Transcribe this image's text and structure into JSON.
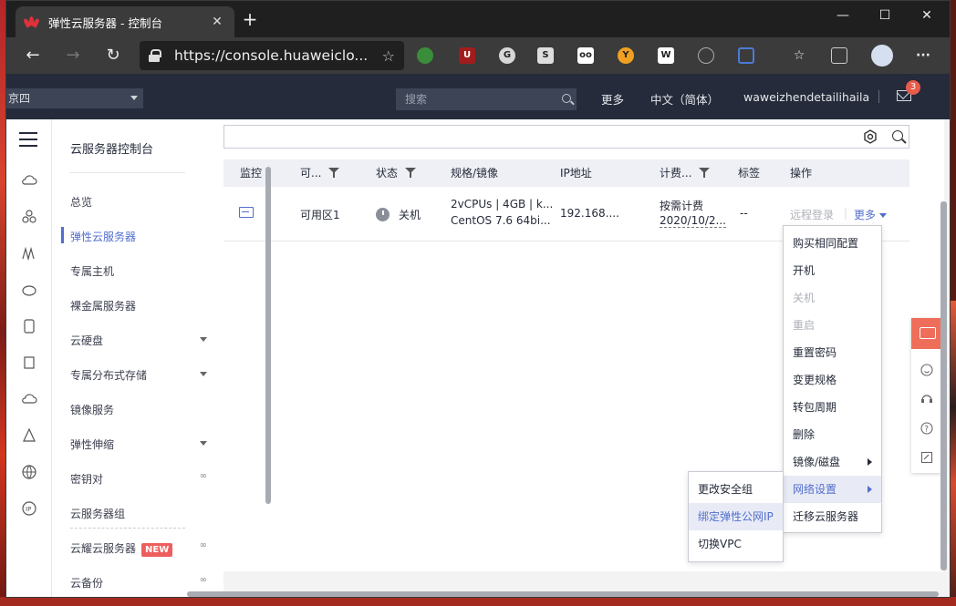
{
  "browser": {
    "tab_title": "弹性云服务器 - 控制台",
    "url": "https://console.huaweiclo...",
    "new_tab": "+",
    "close_tab": "✕",
    "controls": {
      "minimize": "—",
      "maximize": "☐",
      "close": "✕"
    }
  },
  "topbar": {
    "region": "京四",
    "search_placeholder": "搜索",
    "more": "更多",
    "language": "中文（简体）",
    "username": "waweizhendetailihaila",
    "mail_count": "3"
  },
  "sidebar": {
    "header": "云服务器控制台",
    "items": [
      {
        "label": "总览"
      },
      {
        "label": "弹性云服务器"
      },
      {
        "label": "专属主机"
      },
      {
        "label": "裸金属服务器"
      },
      {
        "label": "云硬盘"
      },
      {
        "label": "专属分布式存储"
      },
      {
        "label": "镜像服务"
      },
      {
        "label": "弹性伸缩"
      },
      {
        "label": "密钥对"
      },
      {
        "label": "云服务器组"
      },
      {
        "label": "云耀云服务器"
      },
      {
        "label": "云备份"
      }
    ],
    "new_badge": "NEW"
  },
  "table": {
    "headers": [
      "监控",
      "可...",
      "状态",
      "规格/镜像",
      "IP地址",
      "计费...",
      "标签",
      "操作"
    ],
    "row": {
      "zone": "可用区1",
      "status": "关机",
      "spec_line1": "2vCPUs | 4GB | k...",
      "spec_line2": "CentOS 7.6 64bi...",
      "ip": "192.168....",
      "billing_line1": "按需计费",
      "billing_line2": "2020/10/2...",
      "tags": "--",
      "op_remote": "远程登录",
      "op_more": "更多"
    }
  },
  "more_menu": [
    {
      "label": "购买相同配置",
      "enabled": true
    },
    {
      "label": "开机",
      "enabled": true
    },
    {
      "label": "关机",
      "enabled": false
    },
    {
      "label": "重启",
      "enabled": false
    },
    {
      "label": "重置密码",
      "enabled": true
    },
    {
      "label": "变更规格",
      "enabled": true
    },
    {
      "label": "转包周期",
      "enabled": true
    },
    {
      "label": "删除",
      "enabled": true
    },
    {
      "label": "镜像/磁盘",
      "enabled": true
    },
    {
      "label": "网络设置",
      "enabled": true
    },
    {
      "label": "迁移云服务器",
      "enabled": true
    }
  ],
  "network_submenu": [
    {
      "label": "更改安全组"
    },
    {
      "label": "绑定弹性公网IP"
    },
    {
      "label": "切换VPC"
    }
  ],
  "colors": {
    "accent": "#526ecc",
    "topbar": "#252b3a",
    "badge": "#e85b4a",
    "chat": "#ee6e5a"
  }
}
